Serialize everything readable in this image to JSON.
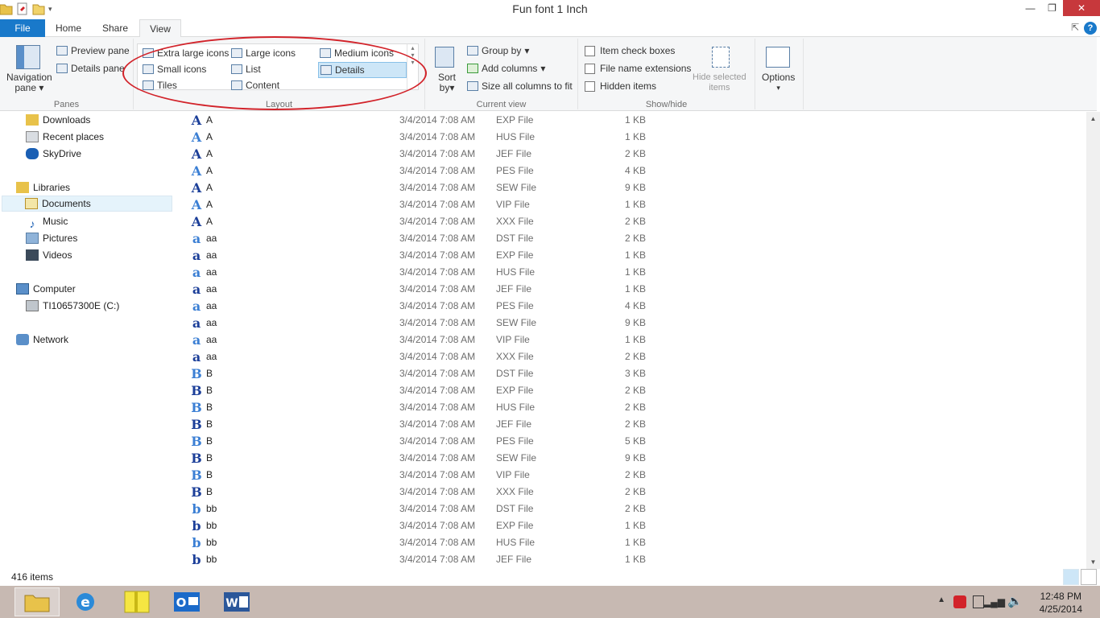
{
  "window": {
    "title": "Fun font 1 Inch"
  },
  "tabs": {
    "file": "File",
    "home": "Home",
    "share": "Share",
    "view": "View"
  },
  "ribbon": {
    "panes": {
      "label": "Panes",
      "navigation_pane": "Navigation",
      "navigation_pane2": "pane",
      "preview_pane": "Preview pane",
      "details_pane": "Details pane"
    },
    "layout": {
      "label": "Layout",
      "extra_large_icons": "Extra large icons",
      "large_icons": "Large icons",
      "medium_icons": "Medium icons",
      "small_icons": "Small icons",
      "list": "List",
      "details": "Details",
      "tiles": "Tiles",
      "content": "Content"
    },
    "current_view": {
      "label": "Current view",
      "sort_by": "Sort",
      "sort_by2": "by",
      "group_by": "Group by",
      "add_columns": "Add columns",
      "size_all_columns": "Size all columns to fit"
    },
    "show_hide": {
      "label": "Show/hide",
      "item_check_boxes": "Item check boxes",
      "file_name_extensions": "File name extensions",
      "hidden_items": "Hidden items",
      "hide_selected": "Hide selected",
      "hide_selected2": "items"
    },
    "options": {
      "label": "Options"
    }
  },
  "nav": {
    "downloads": "Downloads",
    "recent_places": "Recent places",
    "skydrive": "SkyDrive",
    "libraries": "Libraries",
    "documents": "Documents",
    "music": "Music",
    "pictures": "Pictures",
    "videos": "Videos",
    "computer": "Computer",
    "drive": "TI10657300E (C:)",
    "network": "Network"
  },
  "files": [
    {
      "icon": "A",
      "name": "A",
      "date": "3/4/2014 7:08 AM",
      "type": "EXP File",
      "size": "1 KB"
    },
    {
      "icon": "A",
      "name": "A",
      "date": "3/4/2014 7:08 AM",
      "type": "HUS File",
      "size": "1 KB"
    },
    {
      "icon": "A",
      "name": "A",
      "date": "3/4/2014 7:08 AM",
      "type": "JEF File",
      "size": "2 KB"
    },
    {
      "icon": "A",
      "name": "A",
      "date": "3/4/2014 7:08 AM",
      "type": "PES File",
      "size": "4 KB"
    },
    {
      "icon": "A",
      "name": "A",
      "date": "3/4/2014 7:08 AM",
      "type": "SEW File",
      "size": "9 KB"
    },
    {
      "icon": "A",
      "name": "A",
      "date": "3/4/2014 7:08 AM",
      "type": "VIP File",
      "size": "1 KB"
    },
    {
      "icon": "A",
      "name": "A",
      "date": "3/4/2014 7:08 AM",
      "type": "XXX File",
      "size": "2 KB"
    },
    {
      "icon": "a",
      "name": "aa",
      "date": "3/4/2014 7:08 AM",
      "type": "DST File",
      "size": "2 KB"
    },
    {
      "icon": "a",
      "name": "aa",
      "date": "3/4/2014 7:08 AM",
      "type": "EXP File",
      "size": "1 KB"
    },
    {
      "icon": "a",
      "name": "aa",
      "date": "3/4/2014 7:08 AM",
      "type": "HUS File",
      "size": "1 KB"
    },
    {
      "icon": "a",
      "name": "aa",
      "date": "3/4/2014 7:08 AM",
      "type": "JEF File",
      "size": "1 KB"
    },
    {
      "icon": "a",
      "name": "aa",
      "date": "3/4/2014 7:08 AM",
      "type": "PES File",
      "size": "4 KB"
    },
    {
      "icon": "a",
      "name": "aa",
      "date": "3/4/2014 7:08 AM",
      "type": "SEW File",
      "size": "9 KB"
    },
    {
      "icon": "a",
      "name": "aa",
      "date": "3/4/2014 7:08 AM",
      "type": "VIP File",
      "size": "1 KB"
    },
    {
      "icon": "a",
      "name": "aa",
      "date": "3/4/2014 7:08 AM",
      "type": "XXX File",
      "size": "2 KB"
    },
    {
      "icon": "B",
      "name": "B",
      "date": "3/4/2014 7:08 AM",
      "type": "DST File",
      "size": "3 KB"
    },
    {
      "icon": "B",
      "name": "B",
      "date": "3/4/2014 7:08 AM",
      "type": "EXP File",
      "size": "2 KB"
    },
    {
      "icon": "B",
      "name": "B",
      "date": "3/4/2014 7:08 AM",
      "type": "HUS File",
      "size": "2 KB"
    },
    {
      "icon": "B",
      "name": "B",
      "date": "3/4/2014 7:08 AM",
      "type": "JEF File",
      "size": "2 KB"
    },
    {
      "icon": "B",
      "name": "B",
      "date": "3/4/2014 7:08 AM",
      "type": "PES File",
      "size": "5 KB"
    },
    {
      "icon": "B",
      "name": "B",
      "date": "3/4/2014 7:08 AM",
      "type": "SEW File",
      "size": "9 KB"
    },
    {
      "icon": "B",
      "name": "B",
      "date": "3/4/2014 7:08 AM",
      "type": "VIP File",
      "size": "2 KB"
    },
    {
      "icon": "B",
      "name": "B",
      "date": "3/4/2014 7:08 AM",
      "type": "XXX File",
      "size": "2 KB"
    },
    {
      "icon": "b",
      "name": "bb",
      "date": "3/4/2014 7:08 AM",
      "type": "DST File",
      "size": "2 KB"
    },
    {
      "icon": "b",
      "name": "bb",
      "date": "3/4/2014 7:08 AM",
      "type": "EXP File",
      "size": "1 KB"
    },
    {
      "icon": "b",
      "name": "bb",
      "date": "3/4/2014 7:08 AM",
      "type": "HUS File",
      "size": "1 KB"
    },
    {
      "icon": "b",
      "name": "bb",
      "date": "3/4/2014 7:08 AM",
      "type": "JEF File",
      "size": "1 KB"
    }
  ],
  "status": {
    "item_count": "416 items"
  },
  "clock": {
    "time": "12:48 PM",
    "date": "4/25/2014"
  },
  "colors": {
    "accent": "#1979ca",
    "annotation": "#d2232a",
    "taskbar": "#c7b9b2"
  }
}
